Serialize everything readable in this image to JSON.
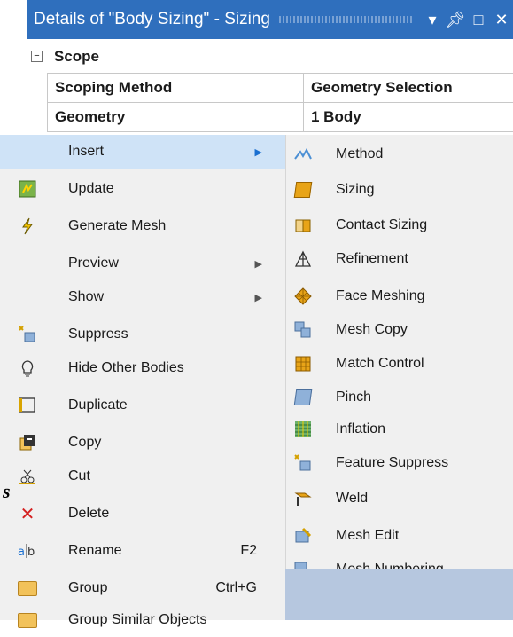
{
  "details": {
    "title": "Details of \"Body Sizing\" - Sizing",
    "btn_pin": "▾",
    "btn_dock": "❘",
    "btn_max": "□",
    "btn_close": "✕",
    "scope_label": "Scope",
    "collapse_glyph": "−",
    "rows": [
      {
        "label": "Scoping Method",
        "value": "Geometry Selection"
      },
      {
        "label": "Geometry",
        "value": "1 Body"
      }
    ]
  },
  "context_menu": {
    "items": [
      {
        "label": "Insert",
        "icon": "none",
        "submenu": true
      },
      {
        "label": "Update",
        "icon": "update-icon"
      },
      {
        "label": "Generate Mesh",
        "icon": "generate-mesh-icon"
      },
      {
        "label": "Preview",
        "icon": "none",
        "submenu": true
      },
      {
        "label": "Show",
        "icon": "none",
        "submenu": true
      },
      {
        "label": "Suppress",
        "icon": "suppress-icon"
      },
      {
        "label": "Hide Other Bodies",
        "icon": "lightbulb-icon"
      },
      {
        "label": "Duplicate",
        "icon": "duplicate-icon"
      },
      {
        "label": "Copy",
        "icon": "copy-icon"
      },
      {
        "label": "Cut",
        "icon": "cut-icon"
      },
      {
        "label": "Delete",
        "icon": "delete-icon"
      },
      {
        "label": "Rename",
        "icon": "rename-icon",
        "shortcut": "F2"
      },
      {
        "label": "Group",
        "icon": "group-icon",
        "shortcut": "Ctrl+G"
      },
      {
        "label": "Group Similar Objects",
        "icon": "group-similar-icon"
      }
    ],
    "arrow_glyph": "▶",
    "delete_glyph": "✕"
  },
  "insert_submenu": {
    "items": [
      {
        "label": "Method"
      },
      {
        "label": "Sizing"
      },
      {
        "label": "Contact Sizing"
      },
      {
        "label": "Refinement"
      },
      {
        "label": "Face Meshing"
      },
      {
        "label": "Mesh Copy"
      },
      {
        "label": "Match Control"
      },
      {
        "label": "Pinch"
      },
      {
        "label": "Inflation"
      },
      {
        "label": "Feature Suppress"
      },
      {
        "label": "Weld"
      },
      {
        "label": "Mesh Edit"
      },
      {
        "label": "Mesh Numbering"
      }
    ]
  },
  "stray_text": "s",
  "colors": {
    "title_bar": "#2f6fbd",
    "menu_bg": "#f0f0f0",
    "hover": "#cfe3f7"
  }
}
